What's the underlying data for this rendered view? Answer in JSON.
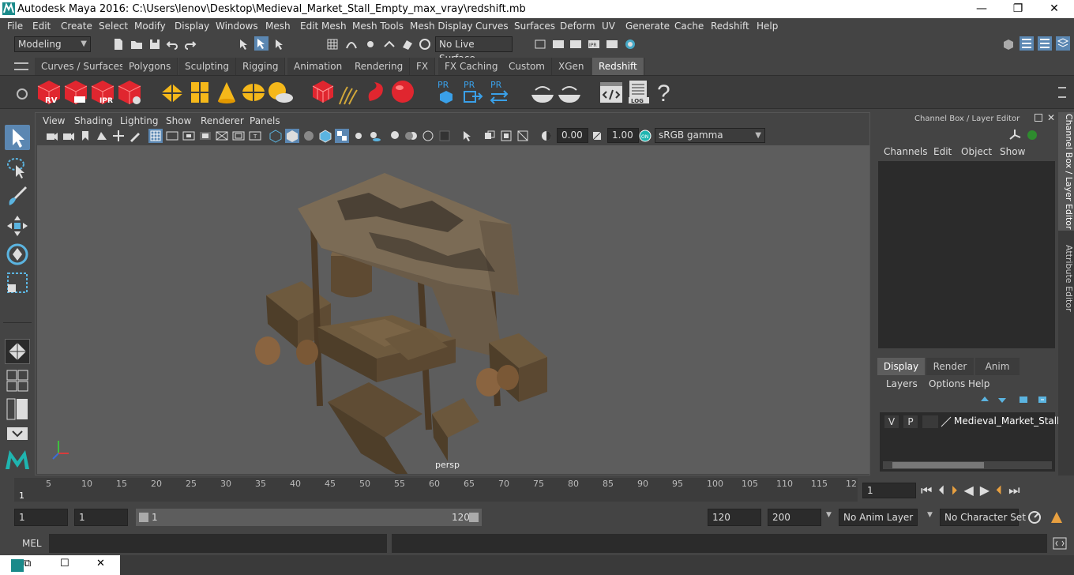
{
  "window": {
    "title": "Autodesk Maya 2016: C:\\Users\\lenov\\Desktop\\Medieval_Market_Stall_Empty_max_vray\\redshift.mb",
    "minimize": "—",
    "maximize": "❐",
    "close": "✕"
  },
  "menubar": [
    "File",
    "Edit",
    "Create",
    "Select",
    "Modify",
    "Display",
    "Windows",
    "Mesh",
    "Edit Mesh",
    "Mesh Tools",
    "Mesh Display",
    "Curves",
    "Surfaces",
    "Deform",
    "UV",
    "Generate",
    "Cache",
    "Redshift",
    "Help"
  ],
  "status": {
    "mode": "Modeling",
    "live_surface": "No Live Surface"
  },
  "shelf_tabs": [
    "Curves / Surfaces",
    "Polygons",
    "Sculpting",
    "Rigging",
    "Animation",
    "Rendering",
    "FX",
    "FX Caching",
    "Custom",
    "XGen",
    "Redshift"
  ],
  "shelf_active": "Redshift",
  "shelf_labels": {
    "rv": "RV",
    "ipr": "IPR",
    "pr1": "PR",
    "pr2": "PR",
    "pr3": "PR",
    "log": "LOG"
  },
  "viewport": {
    "menus": [
      "View",
      "Shading",
      "Lighting",
      "Show",
      "Renderer",
      "Panels"
    ],
    "exposure": "0.00",
    "gamma": "1.00",
    "color_space": "sRGB gamma",
    "camera": "persp"
  },
  "channel_box": {
    "title": "Channel Box / Layer Editor",
    "menus": [
      "Channels",
      "Edit",
      "Object",
      "Show"
    ]
  },
  "layer_editor": {
    "tabs": [
      "Display",
      "Render",
      "Anim"
    ],
    "active_tab": "Display",
    "menus": [
      "Layers",
      "Options",
      "Help"
    ],
    "layer": {
      "v": "V",
      "p": "P",
      "name": "Medieval_Market_Stall_E"
    }
  },
  "side_tabs": [
    "Channel Box / Layer Editor",
    "Attribute Editor"
  ],
  "timeline": {
    "ticks": [
      "5",
      "10",
      "15",
      "20",
      "25",
      "30",
      "35",
      "40",
      "45",
      "50",
      "55",
      "60",
      "65",
      "70",
      "75",
      "80",
      "85",
      "90",
      "95",
      "100",
      "105",
      "110",
      "115",
      "12"
    ],
    "start_mark": "1",
    "current_frame": "1"
  },
  "range": {
    "start": "1",
    "playback_start": "1",
    "slider_start": "1",
    "slider_end": "120",
    "playback_end": "120",
    "end": "200",
    "anim_layer": "No Anim Layer",
    "char_set": "No Character Set"
  },
  "command": {
    "label": "MEL"
  },
  "taskbar": {
    "restore": "⧉",
    "maximize": "☐",
    "close": "✕"
  }
}
